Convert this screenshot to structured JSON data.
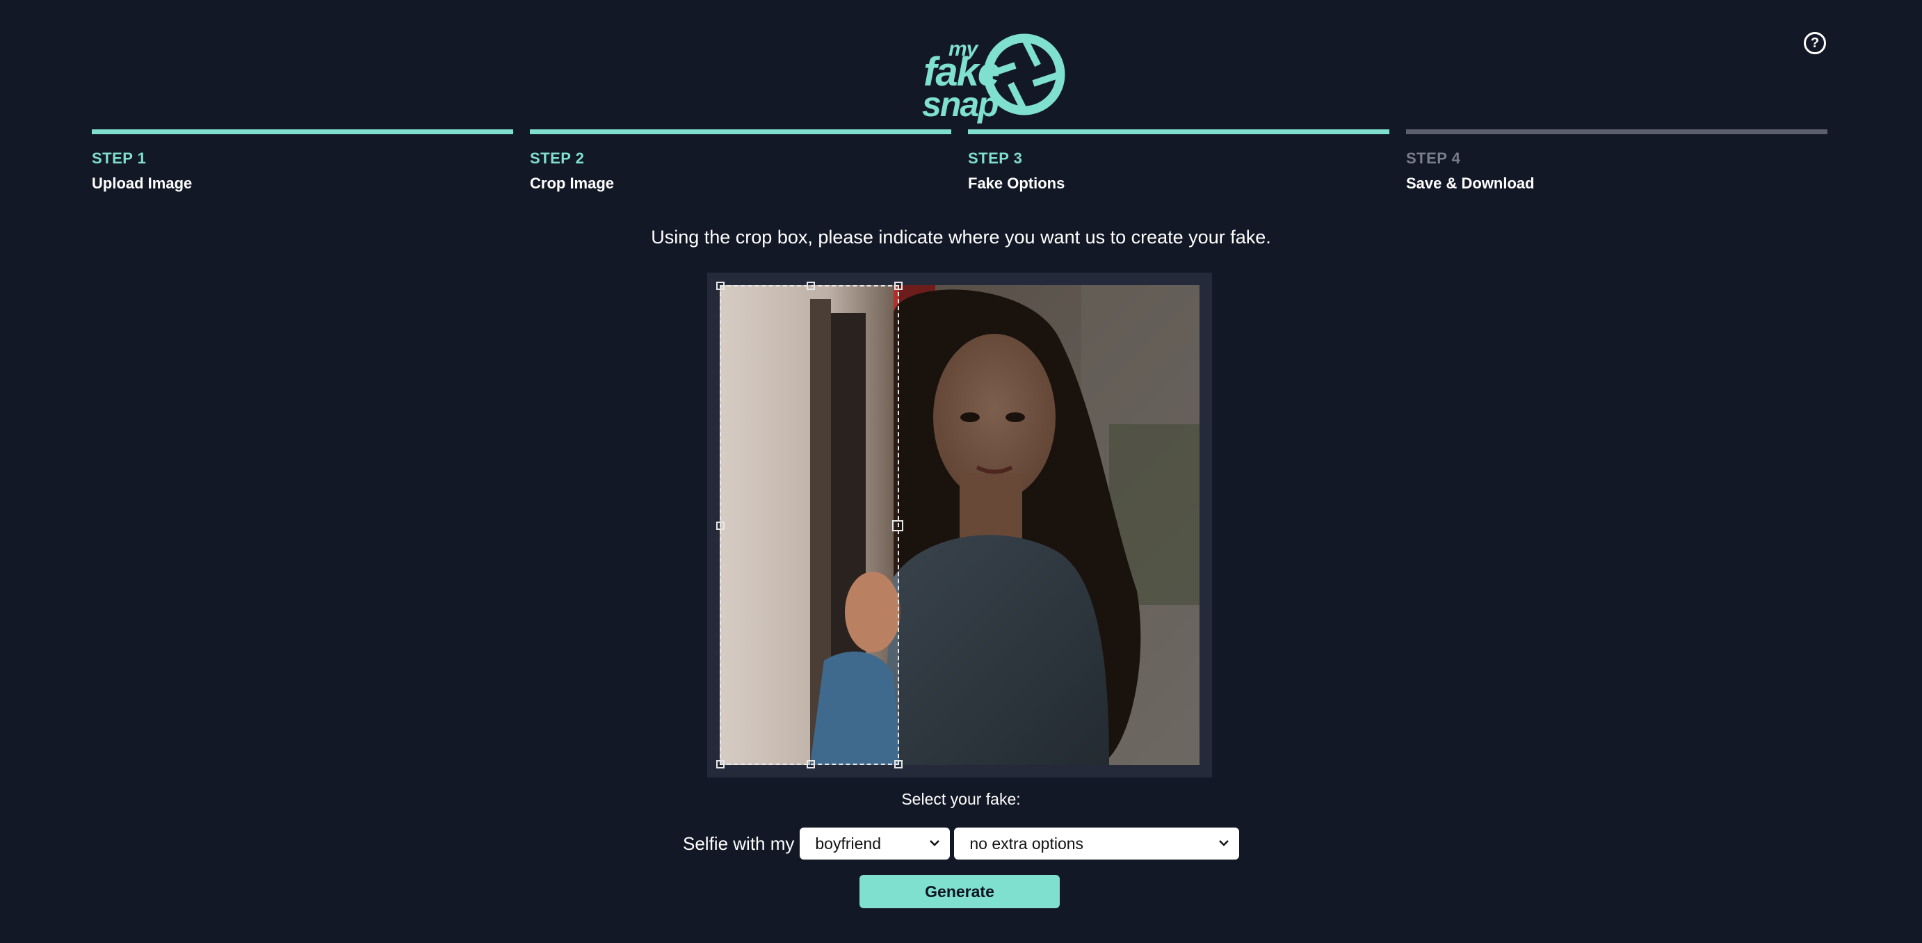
{
  "logo": {
    "my": "my",
    "fake": "fake",
    "snap": "snap",
    "accent_color": "#7fe0cf"
  },
  "help_icon": "?",
  "steps": [
    {
      "num": "STEP 1",
      "label": "Upload Image",
      "active": true
    },
    {
      "num": "STEP 2",
      "label": "Crop Image",
      "active": true
    },
    {
      "num": "STEP 3",
      "label": "Fake Options",
      "active": true
    },
    {
      "num": "STEP 4",
      "label": "Save & Download",
      "active": false
    }
  ],
  "instruction": "Using the crop box, please indicate where you want us to create your fake.",
  "select_title": "Select your fake:",
  "selfie_prefix": "Selfie with my",
  "relation_select": {
    "value": "boyfriend"
  },
  "options_select": {
    "value": "no extra options"
  },
  "generate_button": "Generate",
  "colors": {
    "background": "#131826",
    "accent": "#7fe0cf",
    "inactive": "#5b5f6e"
  }
}
